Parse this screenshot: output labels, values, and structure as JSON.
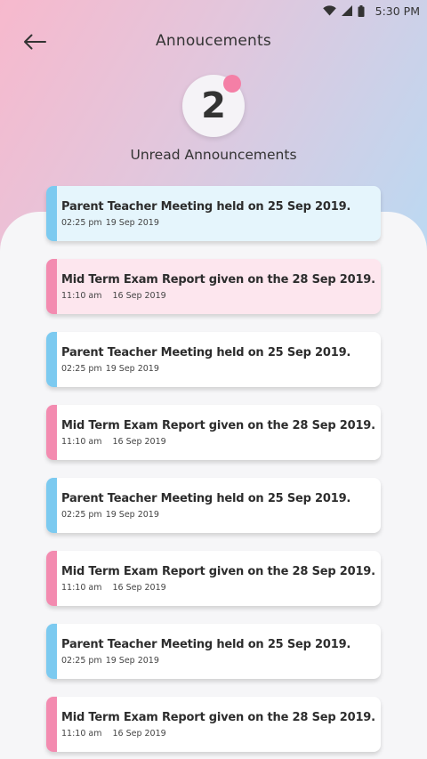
{
  "status_bar": {
    "time": "5:30 PM",
    "icons": [
      "wifi-icon",
      "signal-icon",
      "battery-icon"
    ]
  },
  "header": {
    "title": "Annoucements",
    "back_icon": "arrow-left-icon"
  },
  "summary": {
    "count": "2",
    "caption": "Unread Announcements"
  },
  "colors": {
    "accent_blue": "#7ccaf0",
    "accent_pink": "#f38bb0",
    "badge_dot": "#f47fa6"
  },
  "announcements": [
    {
      "title": "Parent Teacher Meeting held on 25 Sep 2019.",
      "time": "02:25 pm",
      "date": "19 Sep 2019",
      "accent": "blue",
      "unread": true
    },
    {
      "title": "Mid Term Exam Report given on the 28 Sep 2019.",
      "time": "11:10 am",
      "date": "16 Sep 2019",
      "accent": "pink",
      "unread": true
    },
    {
      "title": "Parent Teacher Meeting held on 25 Sep 2019.",
      "time": "02:25 pm",
      "date": "19 Sep 2019",
      "accent": "blue",
      "unread": false
    },
    {
      "title": "Mid Term Exam Report given on the 28 Sep 2019.",
      "time": "11:10 am",
      "date": "16 Sep 2019",
      "accent": "pink",
      "unread": false
    },
    {
      "title": "Parent Teacher Meeting held on 25 Sep 2019.",
      "time": "02:25 pm",
      "date": "19 Sep 2019",
      "accent": "blue",
      "unread": false
    },
    {
      "title": "Mid Term Exam Report given on the 28 Sep 2019.",
      "time": "11:10 am",
      "date": "16 Sep 2019",
      "accent": "pink",
      "unread": false
    },
    {
      "title": "Parent Teacher Meeting held on 25 Sep 2019.",
      "time": "02:25 pm",
      "date": "19 Sep 2019",
      "accent": "blue",
      "unread": false
    },
    {
      "title": "Mid Term Exam Report given on the 28 Sep 2019.",
      "time": "11:10 am",
      "date": "16 Sep 2019",
      "accent": "pink",
      "unread": false
    }
  ]
}
